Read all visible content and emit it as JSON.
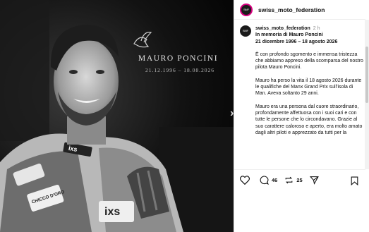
{
  "post": {
    "author": "swiss_moto_federation",
    "time": "2 h",
    "avatar_text": "SMF",
    "caption_title": "In memoria di Mauro Poncini",
    "caption_dates": "21 dicembre 1996 – 18 agosto 2026",
    "paragraphs": [
      "È con profondo sgomento e immensa tristezza che abbiamo appreso della scomparsa del nostro pilota Mauro Poncini.",
      "Mauro ha perso la vita il 18 agosto 2026 durante le qualifiche del Manx Grand Prix sull'isola di Man. Aveva soltanto 29 anni.",
      "Mauro era una persona dal cuore straordinario, profondamente affettuosa con i suoi cari e con tutte le persone che lo circondavano. Grazie al suo carattere caloroso e aperto, era molto amato dagli altri piloti e apprezzato da tutti per la"
    ]
  },
  "image": {
    "memorial_name": "MAURO PONCINI",
    "memorial_dates": "21.12.1996 – 18.08.2026",
    "suit_brands": [
      "ixs",
      "CHICCO D'ORO",
      "ixs"
    ]
  },
  "actions": {
    "likes": "46",
    "reposts": "25"
  },
  "nav": {
    "next_glyph": "›"
  },
  "icons": [
    "heart-icon",
    "comment-icon",
    "repost-icon",
    "send-icon",
    "bookmark-icon",
    "dove-icon"
  ]
}
